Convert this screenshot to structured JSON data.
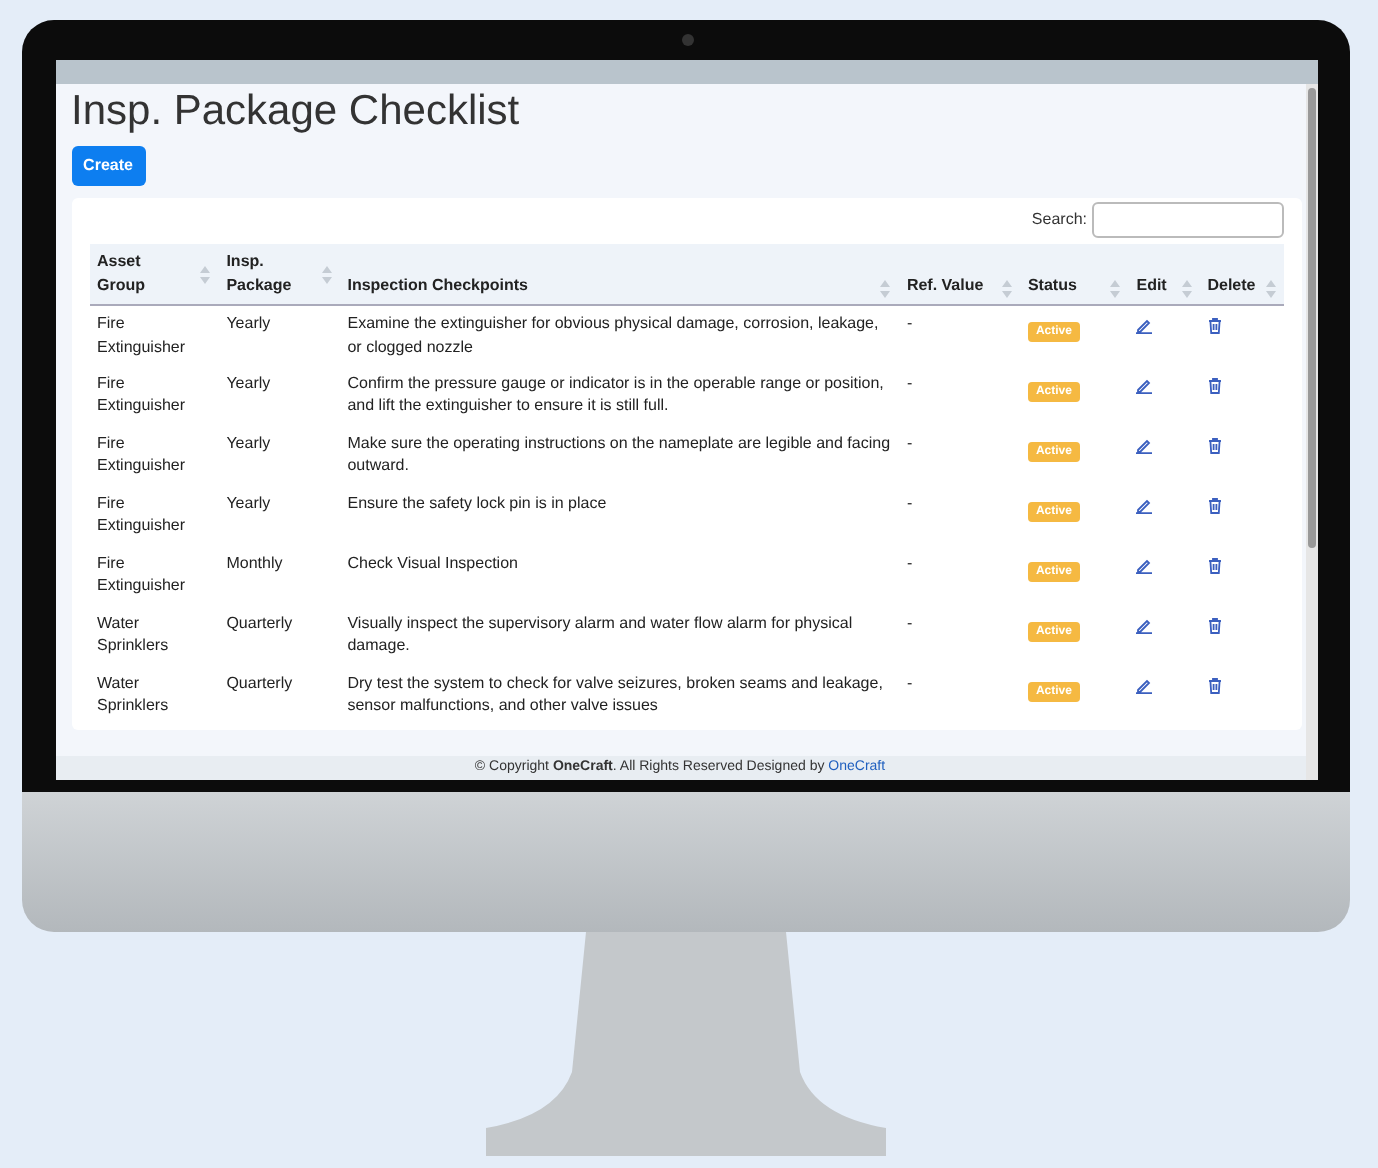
{
  "page": {
    "title": "Insp. Package Checklist",
    "create_button": "Create",
    "search_label": "Search:"
  },
  "table": {
    "columns": [
      "Asset Group",
      "Insp. Package",
      "Inspection Checkpoints",
      "Ref. Value",
      "Status",
      "Edit",
      "Delete"
    ],
    "rows": [
      {
        "asset_group": "Fire Extinguisher",
        "package": "Yearly",
        "checkpoint": "Examine the extinguisher for obvious physical damage, corrosion, leakage, or clogged nozzle",
        "ref_value": "-",
        "status": "Active"
      },
      {
        "asset_group": "Fire Extinguisher",
        "package": "Yearly",
        "checkpoint": "Confirm the pressure gauge or indicator is in the operable range or position, and lift the extinguisher to ensure it is still full.",
        "ref_value": "-",
        "status": "Active"
      },
      {
        "asset_group": "Fire Extinguisher",
        "package": "Yearly",
        "checkpoint": "Make sure the operating instructions on the nameplate are legible and facing outward.",
        "ref_value": "-",
        "status": "Active"
      },
      {
        "asset_group": "Fire Extinguisher",
        "package": "Yearly",
        "checkpoint": "Ensure the safety lock pin is in place",
        "ref_value": "-",
        "status": "Active"
      },
      {
        "asset_group": "Fire Extinguisher",
        "package": "Monthly",
        "checkpoint": "Check Visual Inspection",
        "ref_value": "-",
        "status": "Active"
      },
      {
        "asset_group": "Water Sprinklers",
        "package": "Quarterly",
        "checkpoint": "Visually inspect the supervisory alarm and water flow alarm for physical damage.",
        "ref_value": "-",
        "status": "Active"
      },
      {
        "asset_group": "Water Sprinklers",
        "package": "Quarterly",
        "checkpoint": "Dry test the system to check for valve seizures, broken seams and leakage, sensor malfunctions, and other valve issues",
        "ref_value": "-",
        "status": "Active"
      }
    ]
  },
  "footer": {
    "prefix": "© Copyright ",
    "brand": "OneCraft",
    "middle": ". All Rights Reserved Designed by ",
    "link": "OneCraft"
  }
}
